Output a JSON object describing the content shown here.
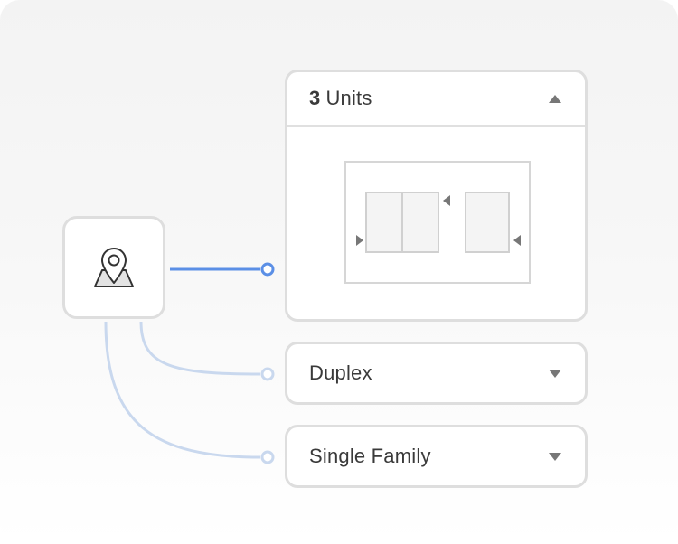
{
  "unit_selector": {
    "expanded_option": {
      "count": "3",
      "label": "Units",
      "expanded": true
    },
    "options": [
      {
        "label": "Duplex",
        "expanded": false
      },
      {
        "label": "Single Family",
        "expanded": false
      }
    ]
  },
  "icons": {
    "location": "map-pin-icon",
    "expanded_caret": "caret-up-icon",
    "collapsed_caret": "caret-down-icon",
    "floorplan": "floorplan-diagram-icon"
  },
  "colors": {
    "active_connector": "#5b8fe6",
    "inactive_connector": "#c9d8ee",
    "card_border": "#dedede",
    "text": "#3a3a3a"
  }
}
